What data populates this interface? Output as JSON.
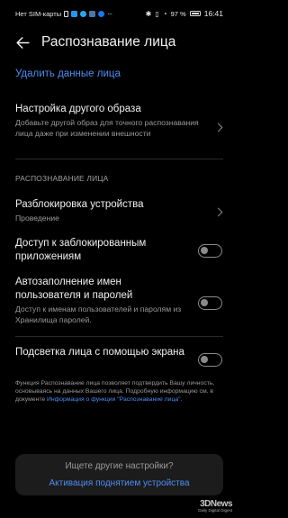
{
  "status_bar": {
    "carrier": "Нет SIM-карты",
    "battery": "97 %",
    "time": "16:41",
    "icons": [
      "sim-icon",
      "messages-icon",
      "telegram-icon",
      "vk-icon",
      "facebook-icon",
      "more-dots-icon",
      "bluetooth-icon",
      "vibrate-icon",
      "wifi-icon",
      "battery-icon"
    ]
  },
  "header": {
    "title": "Распознавание лица"
  },
  "delete_link": "Удалить данные лица",
  "alt_image": {
    "title": "Настройка другого образа",
    "subtitle": "Добавьте другой образ для точного распознавания лица даже при изменении внешности"
  },
  "section_title": "РАСПОЗНАВАНИЕ ЛИЦА",
  "unlock": {
    "title": "Разблокировка устройства",
    "subtitle": "Проведение"
  },
  "locked_apps": {
    "title": "Доступ к заблокированным приложениям",
    "enabled": false
  },
  "autofill": {
    "title": "Автозаполнение имен пользователя и паролей",
    "subtitle": "Доступ к именам пользователей и паролям из Хранилища паролей.",
    "enabled": false
  },
  "screen_light": {
    "title": "Подсветка лица с помощью экрана",
    "enabled": false
  },
  "footnote": {
    "text": "Функция Распознавание лица позволяет подтвердить Вашу личность, основываясь на данных Вашего лица. Подробную информацию см. в документе ",
    "link": "Информация о функции \"Распознавание лица\"",
    "end": "."
  },
  "suggest_card": {
    "question": "Ищете другие настройки?",
    "action": "Активация поднятием устройства"
  },
  "watermark": {
    "brand": "3DNews",
    "sub": "Daily Digital Digest"
  },
  "colors": {
    "background": "#000000",
    "accent": "#4d8df2",
    "card": "#1c1c1c"
  }
}
